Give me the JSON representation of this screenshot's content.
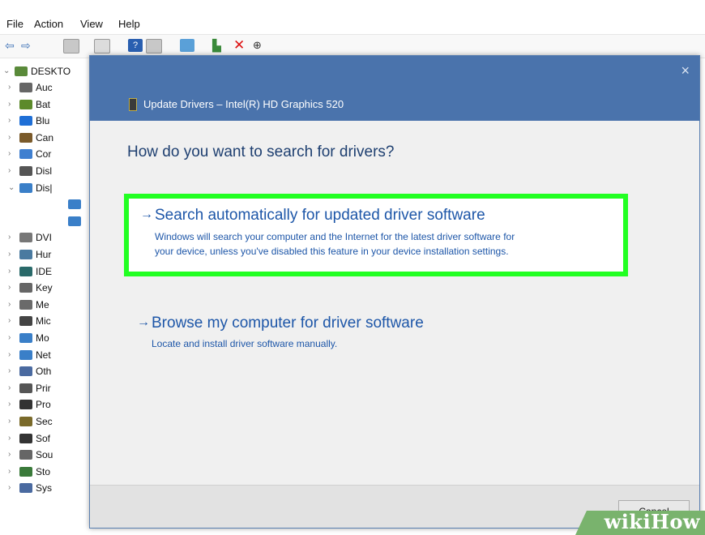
{
  "menubar": {
    "file": "File",
    "action": "Action",
    "view": "View",
    "help": "Help"
  },
  "toolbar": {
    "icons": [
      "back-icon",
      "forward-icon",
      "properties-icon",
      "list-icon",
      "help-icon",
      "view-icon",
      "monitor-icon",
      "update-icon",
      "remove-icon",
      "download-icon"
    ]
  },
  "tree": {
    "root": "DESKTO",
    "items": [
      "Auc",
      "Bat",
      "Blu",
      "Can",
      "Cor",
      "Disl",
      "Dis|",
      "",
      "",
      "DVI",
      "Hur",
      "IDE",
      "Key",
      "Me",
      "Mic",
      "Mo",
      "Net",
      "Oth",
      "Prir",
      "Pro",
      "Sec",
      "Sof",
      "Sou",
      "Sto",
      "Sys"
    ]
  },
  "dialog": {
    "title": "Update Drivers – Intel(R) HD Graphics 520",
    "question": "How do you want to search for drivers?",
    "option1": {
      "arrow": "→",
      "title": "Search automatically for updated driver software",
      "desc_line1": "Windows will search your computer and the Internet for the latest driver software for",
      "desc_line2": "your device, unless you've disabled this feature in your device installation settings."
    },
    "option2": {
      "arrow": "→",
      "title": "Browse my computer for driver software",
      "desc": "Locate and install driver software manually."
    },
    "close": "×",
    "cancel": "Cancel"
  },
  "watermark": {
    "text": "wikiHow"
  },
  "colors": {
    "dialog_header": "#4a73ac",
    "highlight": "#22ff22",
    "link": "#1d56a8"
  }
}
